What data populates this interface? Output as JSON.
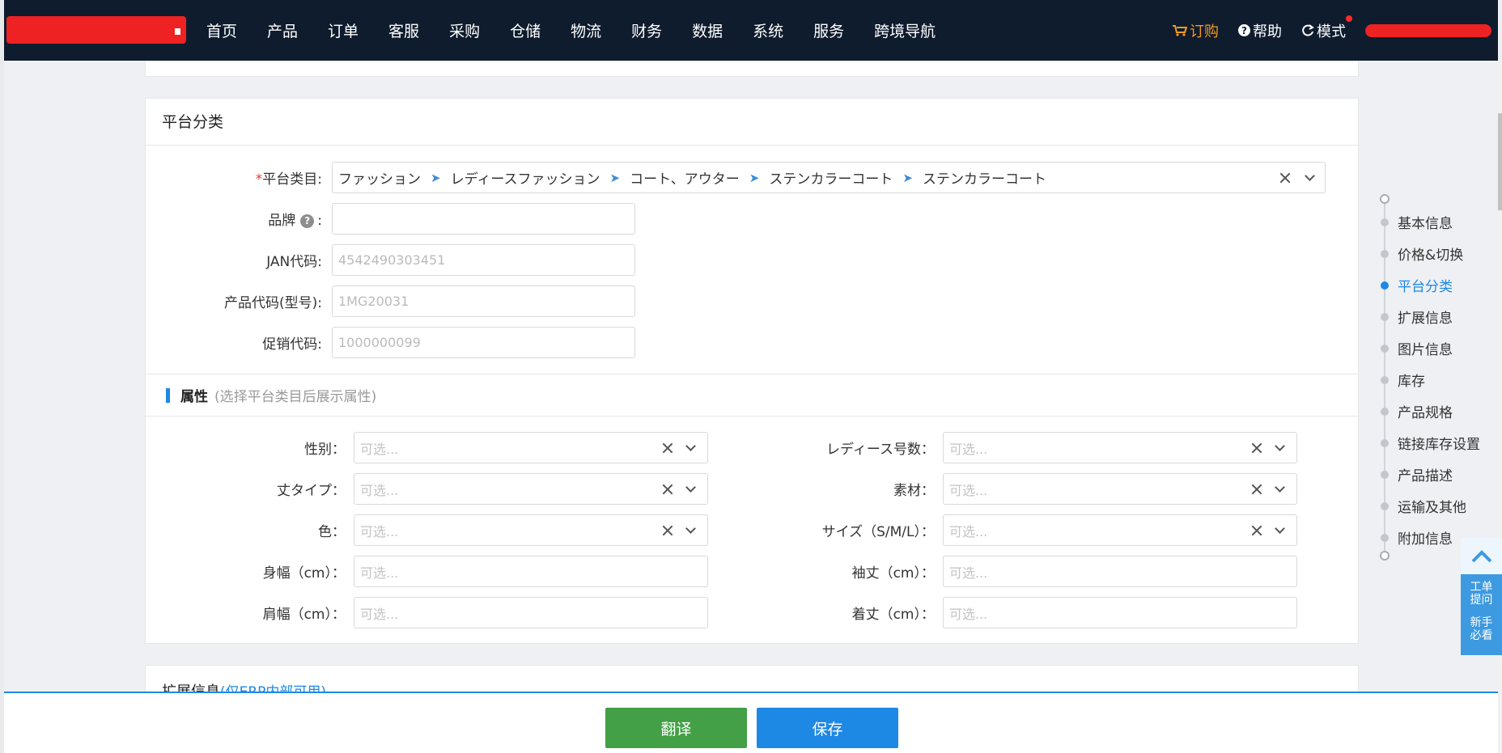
{
  "nav": {
    "items": [
      "首页",
      "产品",
      "订单",
      "客服",
      "采购",
      "仓储",
      "物流",
      "财务",
      "数据",
      "系统",
      "服务",
      "跨境导航"
    ],
    "order_label": "订购",
    "help_label": "帮助",
    "mode_label": "模式"
  },
  "platform_category": {
    "title": "平台分类",
    "category_label": "平台类目:",
    "category_required_mark": "*",
    "category_path": [
      "ファッション",
      "レディースファッション",
      "コート、アウター",
      "ステンカラーコート",
      "ステンカラーコート"
    ],
    "path_separator": "➤",
    "brand_label": "品牌",
    "brand_help": "?",
    "brand_colon": ":",
    "brand_value": "",
    "jan_label": "JAN代码:",
    "jan_placeholder": "4542490303451",
    "product_code_label": "产品代码(型号):",
    "product_code_placeholder": "1MG20031",
    "promo_code_label": "促销代码:",
    "promo_code_placeholder": "1000000099"
  },
  "attributes": {
    "title": "属性",
    "hint": "(选择平台类目后展示属性)",
    "placeholder": "可选...",
    "left": [
      {
        "label": "性别：",
        "clearable": true
      },
      {
        "label": "丈タイプ：",
        "clearable": true
      },
      {
        "label": "色：",
        "clearable": true
      },
      {
        "label": "身幅（cm）：",
        "clearable": false
      },
      {
        "label": "肩幅（cm）：",
        "clearable": false
      }
    ],
    "right": [
      {
        "label": "レディース号数：",
        "clearable": true
      },
      {
        "label": "素材：",
        "clearable": true
      },
      {
        "label": "サイズ（S/M/L）：",
        "clearable": true
      },
      {
        "label": "袖丈（cm）：",
        "clearable": false
      },
      {
        "label": "着丈（cm）：",
        "clearable": false
      }
    ]
  },
  "extension": {
    "title": "扩展信息",
    "note": "(仅ERP内部可用)"
  },
  "anchor_nav": {
    "items": [
      "基本信息",
      "价格&切换",
      "平台分类",
      "扩展信息",
      "图片信息",
      "库存",
      "产品规格",
      "链接库存设置",
      "产品描述",
      "运输及其他",
      "附加信息"
    ],
    "active": "平台分类"
  },
  "float_widget": {
    "line1": "工单",
    "line2": "提问",
    "line3": "新手",
    "line4": "必看"
  },
  "actions": {
    "translate": "翻译",
    "save": "保存"
  },
  "colors": {
    "nav_bg": "#0f1c2e",
    "accent": "#1e88e5",
    "order": "#f39a20",
    "translate_btn": "#43a047"
  }
}
